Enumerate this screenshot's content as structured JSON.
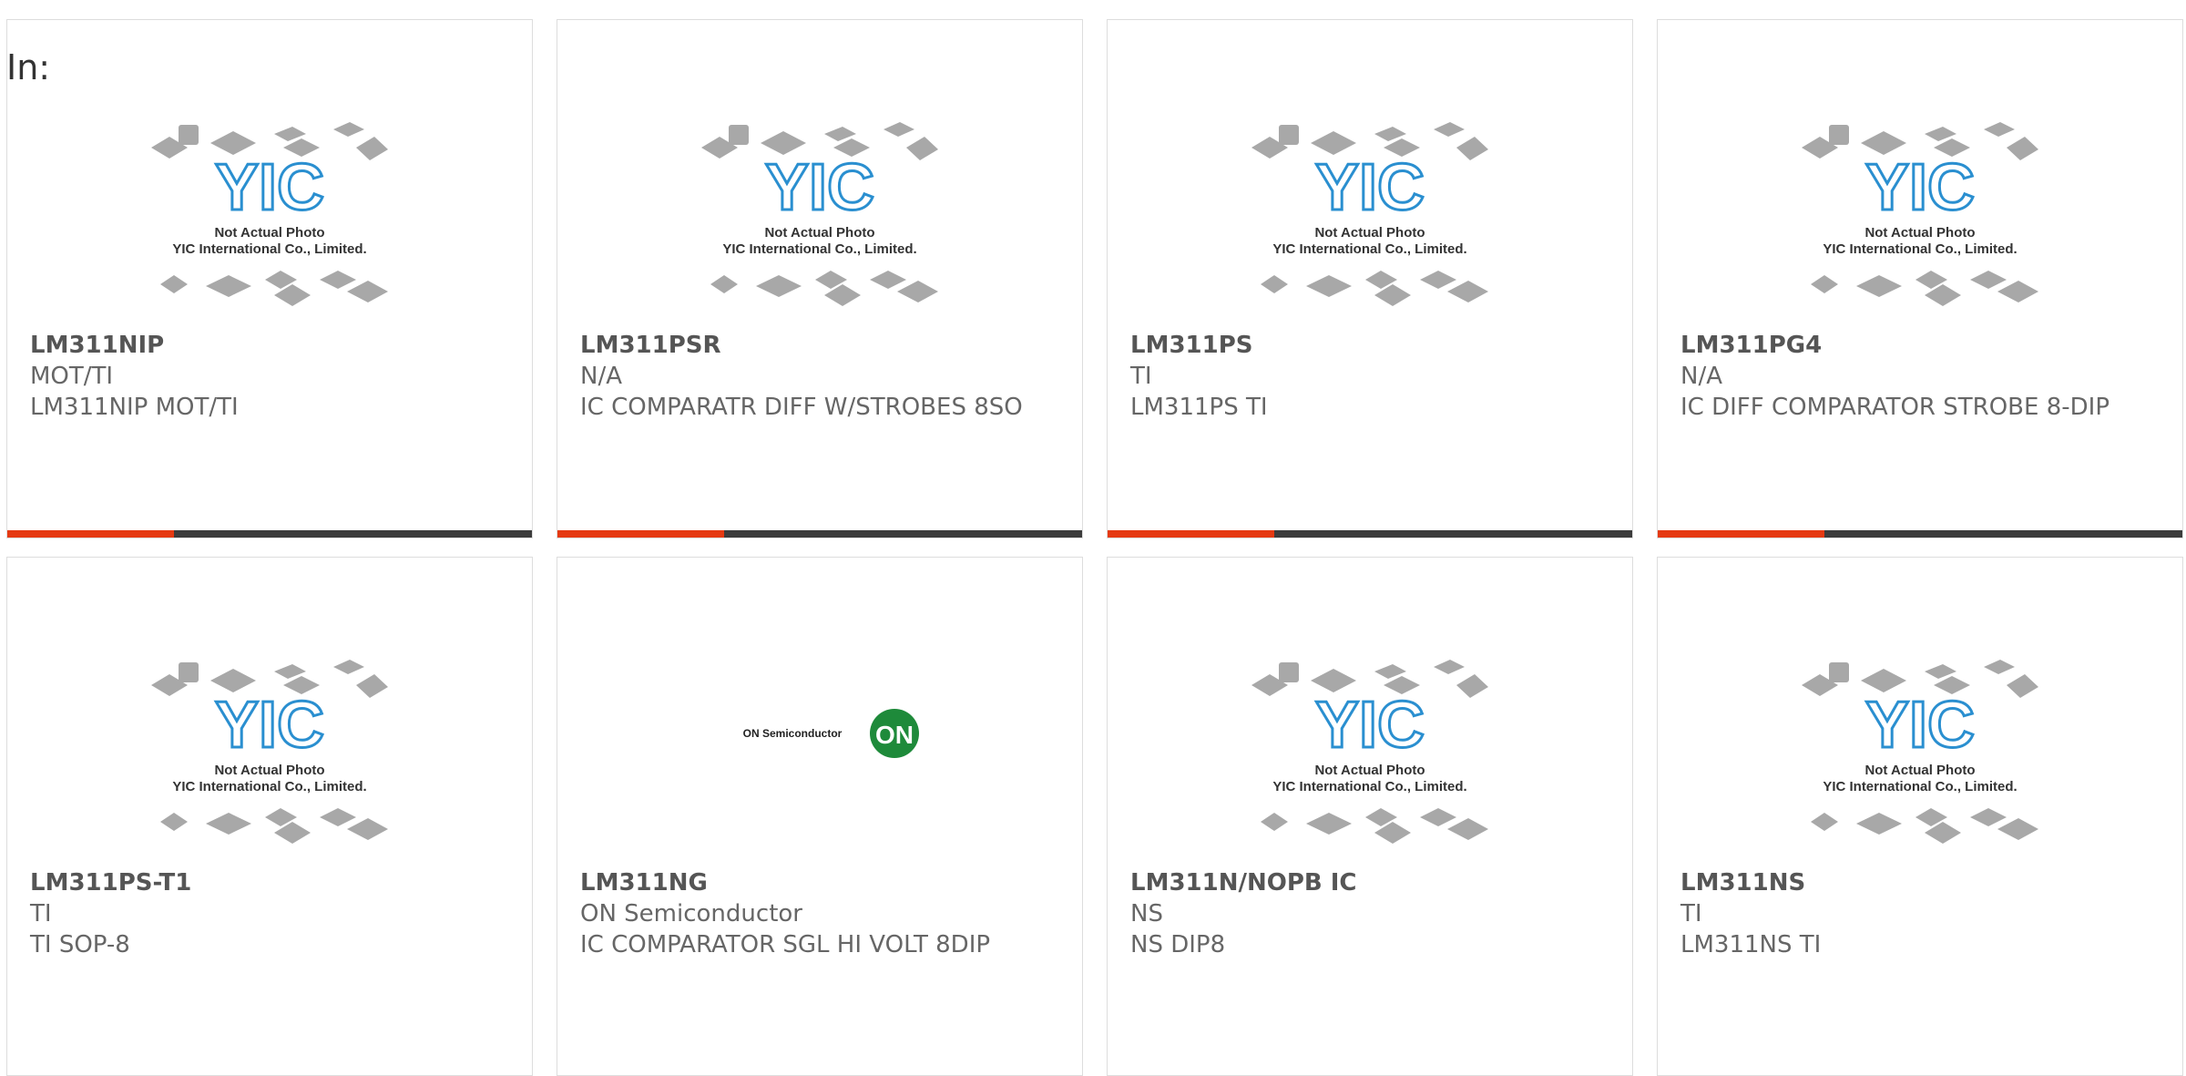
{
  "filter": {
    "label": "In:"
  },
  "placeholder_image": {
    "caption_line1": "Not Actual Photo",
    "caption_line2": "YIC International Co., Limited.",
    "logo_text": "YIC"
  },
  "on_logo": {
    "text": "ON Semiconductor",
    "mark": "ON"
  },
  "products": [
    {
      "part": "LM311NIP",
      "maker": "MOT/TI",
      "desc": "LM311NIP MOT/TI"
    },
    {
      "part": "LM311PSR",
      "maker": "N/A",
      "desc": "IC COMPARATR DIFF W/STROBES 8SO"
    },
    {
      "part": "LM311PS",
      "maker": "TI",
      "desc": "LM311PS TI"
    },
    {
      "part": "LM311PG4",
      "maker": "N/A",
      "desc": "IC DIFF COMPARATOR STROBE 8-DIP"
    },
    {
      "part": "LM311PS-T1",
      "maker": "TI",
      "desc": "TI SOP-8"
    },
    {
      "part": "LM311NG",
      "maker": "ON Semiconductor",
      "desc": "IC COMPARATOR SGL HI VOLT 8DIP"
    },
    {
      "part": "LM311N/NOPB IC",
      "maker": "NS",
      "desc": "NS DIP8"
    },
    {
      "part": "LM311NS",
      "maker": "TI",
      "desc": "LM311NS TI"
    }
  ],
  "colors": {
    "accent": "#e53a12",
    "bar": "#3c3c3c",
    "logo_blue": "#2a8fd0",
    "on_green": "#1e8a3a"
  }
}
